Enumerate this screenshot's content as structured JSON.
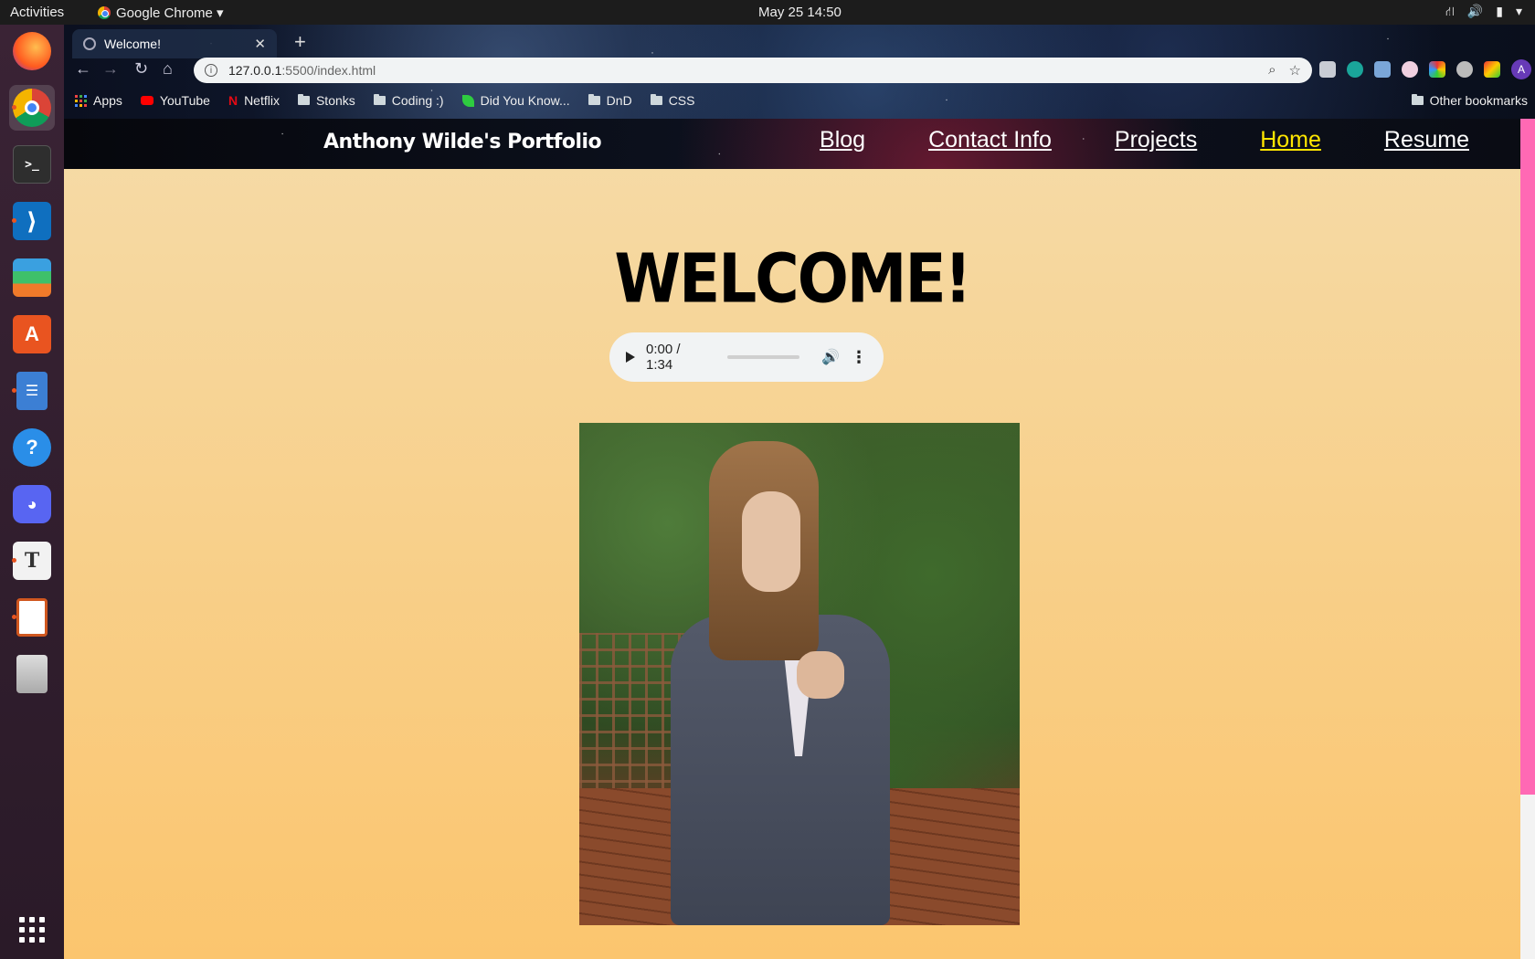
{
  "topbar": {
    "activities": "Activities",
    "app_name": "Google Chrome ▾",
    "clock": "May 25  14:50",
    "tray_icons": [
      "network-icon",
      "volume-icon",
      "battery-icon",
      "power-menu-icon"
    ]
  },
  "dock": {
    "apps": [
      "firefox",
      "google-chrome",
      "terminal",
      "vscode",
      "layers-app",
      "software-center",
      "file-manager",
      "help",
      "discord",
      "typora",
      "impress",
      "archive-manager"
    ],
    "show_apps_icon": "grid-icon"
  },
  "browser": {
    "tab_title": "Welcome!",
    "url_host": "127.0.0.1",
    "url_rest": ":5500/index.html",
    "bookmarks": [
      {
        "label": "Apps",
        "icon": "apps-grid-icon"
      },
      {
        "label": "YouTube",
        "icon": "youtube-icon"
      },
      {
        "label": "Netflix",
        "icon": "netflix-icon"
      },
      {
        "label": "Stonks",
        "icon": "folder-icon"
      },
      {
        "label": "Coding :)",
        "icon": "folder-icon"
      },
      {
        "label": "Did You Know...",
        "icon": "leaf-icon"
      },
      {
        "label": "DnD",
        "icon": "folder-icon"
      },
      {
        "label": "CSS",
        "icon": "folder-icon"
      }
    ],
    "other_bookmarks": "Other bookmarks",
    "profile_initial": "A"
  },
  "site": {
    "title": "Anthony Wilde's Portfolio",
    "nav": [
      "Blog",
      "Contact Info",
      "Projects",
      "Home",
      "Resume"
    ],
    "current": "Home",
    "heading": "WELCOME!",
    "audio_time": "0:00 / 1:34",
    "audio_progress": 0.0
  },
  "colors": {
    "current_nav": "#ffe600",
    "page_gradient_top": "#f5dba8",
    "page_gradient_bottom": "#fbc56e",
    "scrollbar_thumb": "#ff69b4"
  }
}
